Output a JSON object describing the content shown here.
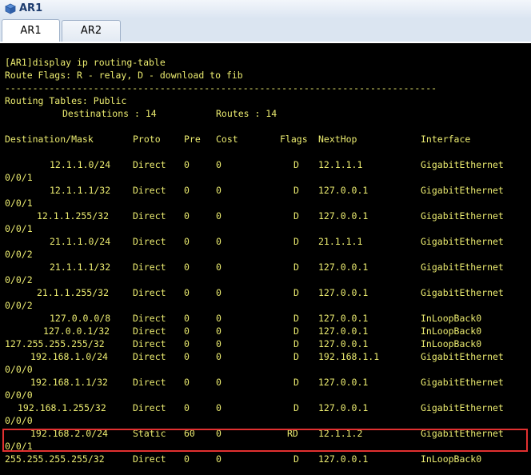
{
  "window": {
    "title": "AR1"
  },
  "tabs": [
    {
      "label": "AR1"
    },
    {
      "label": "AR2"
    }
  ],
  "terminal": {
    "command": "[AR1]display ip routing-table",
    "flags_line": "Route Flags: R - relay, D - download to fib",
    "separator": "------------------------------------------------------------------------------",
    "tables_line": "Routing Tables: Public",
    "dest_label": "Destinations : 14",
    "routes_label": "Routes : 14",
    "headers": {
      "dest": "Destination/Mask",
      "proto": "Proto",
      "pre": "Pre",
      "cost": "Cost",
      "flags": "Flags",
      "nexthop": "NextHop",
      "iface": "Interface"
    },
    "routes": [
      {
        "dest": "12.1.1.0/24",
        "proto": "Direct",
        "pre": "0",
        "cost": "0",
        "flags": "D",
        "nexthop": "12.1.1.1",
        "iface": "GigabitEthernet",
        "cont": "0/0/1"
      },
      {
        "dest": "12.1.1.1/32",
        "proto": "Direct",
        "pre": "0",
        "cost": "0",
        "flags": "D",
        "nexthop": "127.0.0.1",
        "iface": "GigabitEthernet",
        "cont": "0/0/1"
      },
      {
        "dest": "12.1.1.255/32",
        "proto": "Direct",
        "pre": "0",
        "cost": "0",
        "flags": "D",
        "nexthop": "127.0.0.1",
        "iface": "GigabitEthernet",
        "cont": "0/0/1"
      },
      {
        "dest": "21.1.1.0/24",
        "proto": "Direct",
        "pre": "0",
        "cost": "0",
        "flags": "D",
        "nexthop": "21.1.1.1",
        "iface": "GigabitEthernet",
        "cont": "0/0/2"
      },
      {
        "dest": "21.1.1.1/32",
        "proto": "Direct",
        "pre": "0",
        "cost": "0",
        "flags": "D",
        "nexthop": "127.0.0.1",
        "iface": "GigabitEthernet",
        "cont": "0/0/2"
      },
      {
        "dest": "21.1.1.255/32",
        "proto": "Direct",
        "pre": "0",
        "cost": "0",
        "flags": "D",
        "nexthop": "127.0.0.1",
        "iface": "GigabitEthernet",
        "cont": "0/0/2"
      },
      {
        "dest": "127.0.0.0/8",
        "proto": "Direct",
        "pre": "0",
        "cost": "0",
        "flags": "D",
        "nexthop": "127.0.0.1",
        "iface": "InLoopBack0",
        "cont": ""
      },
      {
        "dest": "127.0.0.1/32",
        "proto": "Direct",
        "pre": "0",
        "cost": "0",
        "flags": "D",
        "nexthop": "127.0.0.1",
        "iface": "InLoopBack0",
        "cont": ""
      },
      {
        "dest": "127.255.255.255/32",
        "proto": "Direct",
        "pre": "0",
        "cost": "0",
        "flags": "D",
        "nexthop": "127.0.0.1",
        "iface": "InLoopBack0",
        "cont": ""
      },
      {
        "dest": "192.168.1.0/24",
        "proto": "Direct",
        "pre": "0",
        "cost": "0",
        "flags": "D",
        "nexthop": "192.168.1.1",
        "iface": "GigabitEthernet",
        "cont": "0/0/0"
      },
      {
        "dest": "192.168.1.1/32",
        "proto": "Direct",
        "pre": "0",
        "cost": "0",
        "flags": "D",
        "nexthop": "127.0.0.1",
        "iface": "GigabitEthernet",
        "cont": "0/0/0"
      },
      {
        "dest": "192.168.1.255/32",
        "proto": "Direct",
        "pre": "0",
        "cost": "0",
        "flags": "D",
        "nexthop": "127.0.0.1",
        "iface": "GigabitEthernet",
        "cont": "0/0/0"
      },
      {
        "dest": "192.168.2.0/24",
        "proto": "Static",
        "pre": "60",
        "cost": "0",
        "flags": "RD",
        "nexthop": "12.1.1.2",
        "iface": "GigabitEthernet",
        "cont": "0/0/1"
      },
      {
        "dest": "255.255.255.255/32",
        "proto": "Direct",
        "pre": "0",
        "cost": "0",
        "flags": "D",
        "nexthop": "127.0.0.1",
        "iface": "InLoopBack0",
        "cont": ""
      }
    ]
  },
  "highlight": {
    "color": "#e23030",
    "route_index": 12
  },
  "colors": {
    "terminal_bg": "#000000",
    "terminal_text": "#ecec70"
  }
}
